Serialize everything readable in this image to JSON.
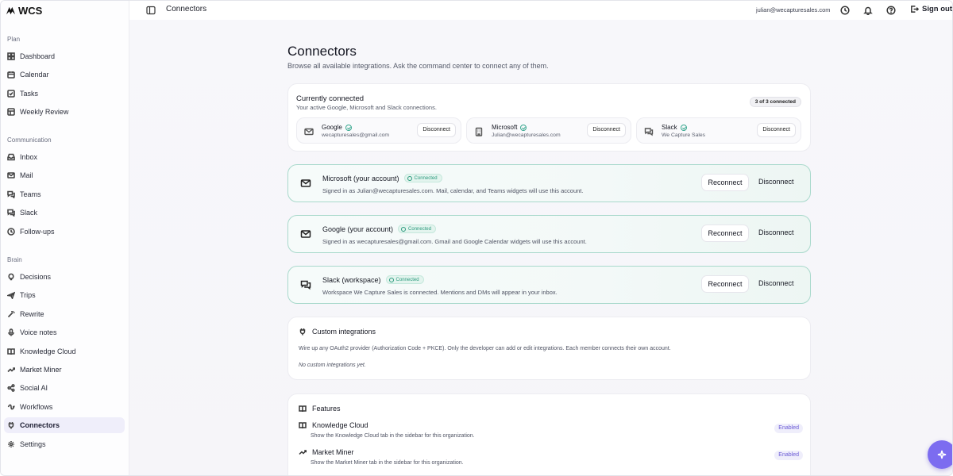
{
  "app": {
    "logo": "WCS"
  },
  "sidebar": {
    "sections": [
      {
        "label": "Plan",
        "items": [
          {
            "label": "Dashboard",
            "icon": "dashboard-icon"
          },
          {
            "label": "Calendar",
            "icon": "calendar-icon"
          },
          {
            "label": "Tasks",
            "icon": "tasks-icon"
          },
          {
            "label": "Weekly Review",
            "icon": "weekly-review-icon"
          }
        ]
      },
      {
        "label": "Communication",
        "items": [
          {
            "label": "Inbox",
            "icon": "inbox-icon"
          },
          {
            "label": "Mail",
            "icon": "mail-icon"
          },
          {
            "label": "Teams",
            "icon": "teams-icon"
          },
          {
            "label": "Slack",
            "icon": "slack-icon"
          },
          {
            "label": "Follow-ups",
            "icon": "follow-ups-icon"
          }
        ]
      },
      {
        "label": "Brain",
        "items": [
          {
            "label": "Decisions",
            "icon": "lightbulb-icon"
          },
          {
            "label": "Trips",
            "icon": "plane-icon"
          },
          {
            "label": "Rewrite",
            "icon": "wand-icon"
          },
          {
            "label": "Voice notes",
            "icon": "mic-icon"
          },
          {
            "label": "Knowledge Cloud",
            "icon": "book-icon"
          },
          {
            "label": "Market Miner",
            "icon": "trend-icon"
          },
          {
            "label": "Social AI",
            "icon": "share-icon"
          },
          {
            "label": "Workflows",
            "icon": "workflow-icon"
          },
          {
            "label": "Connectors",
            "icon": "plug-icon",
            "active": true
          },
          {
            "label": "Settings",
            "icon": "gear-icon"
          }
        ]
      }
    ]
  },
  "topbar": {
    "title": "Connectors",
    "email": "julian@wecapturesales.com",
    "sign_out": "Sign out"
  },
  "page": {
    "title": "Connectors",
    "subtitle": "Browse all available integrations. Ask the command center to connect any of them."
  },
  "currently_connected": {
    "title": "Currently connected",
    "subtitle": "Your active Google, Microsoft and Slack connections.",
    "badge": "3 of 3 connected",
    "items": [
      {
        "name": "Google",
        "detail": "wecapturesales@gmail.com",
        "button": "Disconnect",
        "icon": "mail-icon"
      },
      {
        "name": "Microsoft",
        "detail": "Julian@wecapturesales.com",
        "button": "Disconnect",
        "icon": "building-icon"
      },
      {
        "name": "Slack",
        "detail": "We Capture Sales",
        "button": "Disconnect",
        "icon": "chat-icon"
      }
    ]
  },
  "accounts": [
    {
      "name": "Microsoft (your account)",
      "badge": "Connected",
      "detail": "Signed in as Julian@wecapturesales.com. Mail, calendar, and Teams widgets will use this account.",
      "reconnect": "Reconnect",
      "disconnect": "Disconnect",
      "icon": "mail-icon"
    },
    {
      "name": "Google (your account)",
      "badge": "Connected",
      "detail": "Signed in as wecapturesales@gmail.com. Gmail and Google Calendar widgets will use this account.",
      "reconnect": "Reconnect",
      "disconnect": "Disconnect",
      "icon": "mail-icon"
    },
    {
      "name": "Slack (workspace)",
      "badge": "Connected",
      "detail": "Workspace We Capture Sales is connected. Mentions and DMs will appear in your inbox.",
      "reconnect": "Reconnect",
      "disconnect": "Disconnect",
      "icon": "chat-icon"
    }
  ],
  "custom": {
    "title": "Custom integrations",
    "description": "Wire up any OAuth2 provider (Authorization Code + PKCE). Only the developer can add or edit integrations. Each member connects their own account.",
    "empty": "No custom integrations yet."
  },
  "features": {
    "title": "Features",
    "items": [
      {
        "name": "Knowledge Cloud",
        "description": "Show the Knowledge Cloud tab in the sidebar for this organization.",
        "status": "Enabled"
      },
      {
        "name": "Market Miner",
        "description": "Show the Market Miner tab in the sidebar for this organization.",
        "status": "Enabled"
      }
    ]
  },
  "colors": {
    "accent": "#7c6cf0",
    "connected": "#2b9a7d"
  }
}
